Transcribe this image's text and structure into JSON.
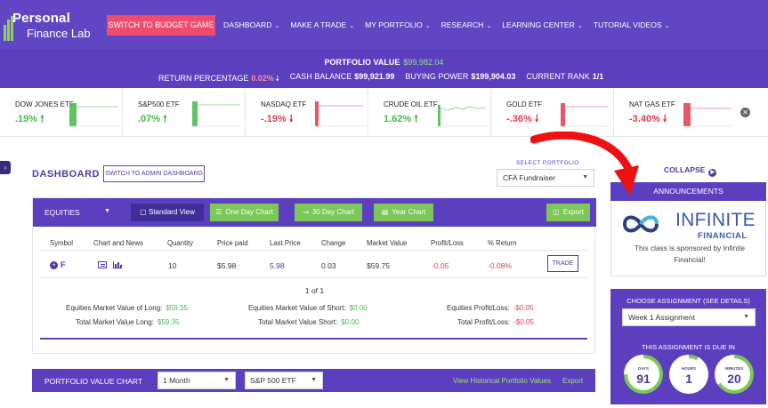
{
  "logo": {
    "line1": "Personal",
    "line2": "Finance Lab"
  },
  "nav": {
    "budget_button": "SWITCH TO BUDGET GAME",
    "items": [
      {
        "label": "DASHBOARD"
      },
      {
        "label": "MAKE A TRADE"
      },
      {
        "label": "MY PORTFOLIO"
      },
      {
        "label": "RESEARCH"
      },
      {
        "label": "LEARNING CENTER"
      },
      {
        "label": "TUTORIAL VIDEOS"
      }
    ],
    "chevron_icon": "chevron-down-icon"
  },
  "summary": {
    "portfolio_value_label": "PORTFOLIO VALUE",
    "portfolio_value": "$99,982.04",
    "return_pct_label": "RETURN PERCENTAGE",
    "return_pct": "0.02%",
    "cash_balance_label": "CASH BALANCE",
    "cash_balance": "$99,921.99",
    "buying_power_label": "BUYING POWER",
    "buying_power": "$199,904.03",
    "current_rank_label": "CURRENT RANK",
    "current_rank": "1/1"
  },
  "tickers": [
    {
      "name": "DOW JONES ETF",
      "change": ".19%",
      "direction": "up"
    },
    {
      "name": "S&P500 ETF",
      "change": ".07%",
      "direction": "up"
    },
    {
      "name": "NASDAQ ETF",
      "change": "-.19%",
      "direction": "down"
    },
    {
      "name": "CRUDE OIL ETF",
      "change": "1.62%",
      "direction": "up"
    },
    {
      "name": "GOLD ETF",
      "change": "-.36%",
      "direction": "down"
    },
    {
      "name": "NAT GAS ETF",
      "change": "-3.40%",
      "direction": "down"
    }
  ],
  "colors": {
    "up": "#47b84a",
    "down": "#e43a4b",
    "brand": "#5b3fbf",
    "accent": "#ef4b6c"
  },
  "dashboard": {
    "title": "DASHBOARD",
    "admin_button": "SWITCH TO ADMIN DASHBOARD",
    "select_label": "SELECT PORTFOLIO",
    "portfolio_selected": "CFA Fundraiser"
  },
  "equities": {
    "dropdown": "EQUITIES",
    "buttons": {
      "standard_view": "Standard View",
      "one_day": "One Day Chart",
      "thirty_day": "30 Day Chart",
      "year": "Year Chart",
      "export": "Export"
    },
    "columns": [
      "Symbol",
      "Chart and News",
      "Quantity",
      "Price paid",
      "Last Price",
      "Change",
      "Market Value",
      "Profit/Loss",
      "% Return"
    ],
    "rows": [
      {
        "symbol": "F",
        "quantity": "10",
        "price_paid": "$5.98",
        "last_price": "5.98",
        "change": "0.03",
        "market_value": "$59.75",
        "profit_loss": "-0.05",
        "pct_return": "-0.08%",
        "action": "TRADE"
      }
    ],
    "pager": "1 of 1",
    "totals": {
      "mv_long_label": "Equities Market Value of Long:",
      "mv_long": "$59.35",
      "mv_short_label": "Equities Market Value of Short:",
      "mv_short": "$0.00",
      "pl_label": "Equities Profit/Loss:",
      "pl": "-$0.05",
      "total_long_label": "Total Market Value Long:",
      "total_long": "$59.35",
      "total_short_label": "Total Market Value Short:",
      "total_short": "$0.00",
      "total_pl_label": "Total Profit/Loss:",
      "total_pl": "-$0.05"
    }
  },
  "pv_chart": {
    "title": "PORTFOLIO VALUE CHART",
    "period": "1 Month",
    "benchmark": "S&P 500 ETF",
    "history_link": "View Historical Portfolio Values",
    "export_link": "Export"
  },
  "sidebar": {
    "collapse": "COLLAPSE",
    "announcements": "ANNOUNCEMENTS",
    "sponsor_line1": "INFINITE",
    "sponsor_line2": "FINANCIAL",
    "sponsor_text": "This class is sponsored by Infinite Financial!",
    "choose_label": "CHOOSE ASSIGNMENT (SEE DETAILS)",
    "assignment": "Week 1 Assignment",
    "due_label": "THIS ASSIGNMENT IS DUE IN",
    "due": [
      {
        "unit": "DAYS",
        "value": "91"
      },
      {
        "unit": "HOURS",
        "value": "1"
      },
      {
        "unit": "MINUTES",
        "value": "20"
      }
    ]
  }
}
